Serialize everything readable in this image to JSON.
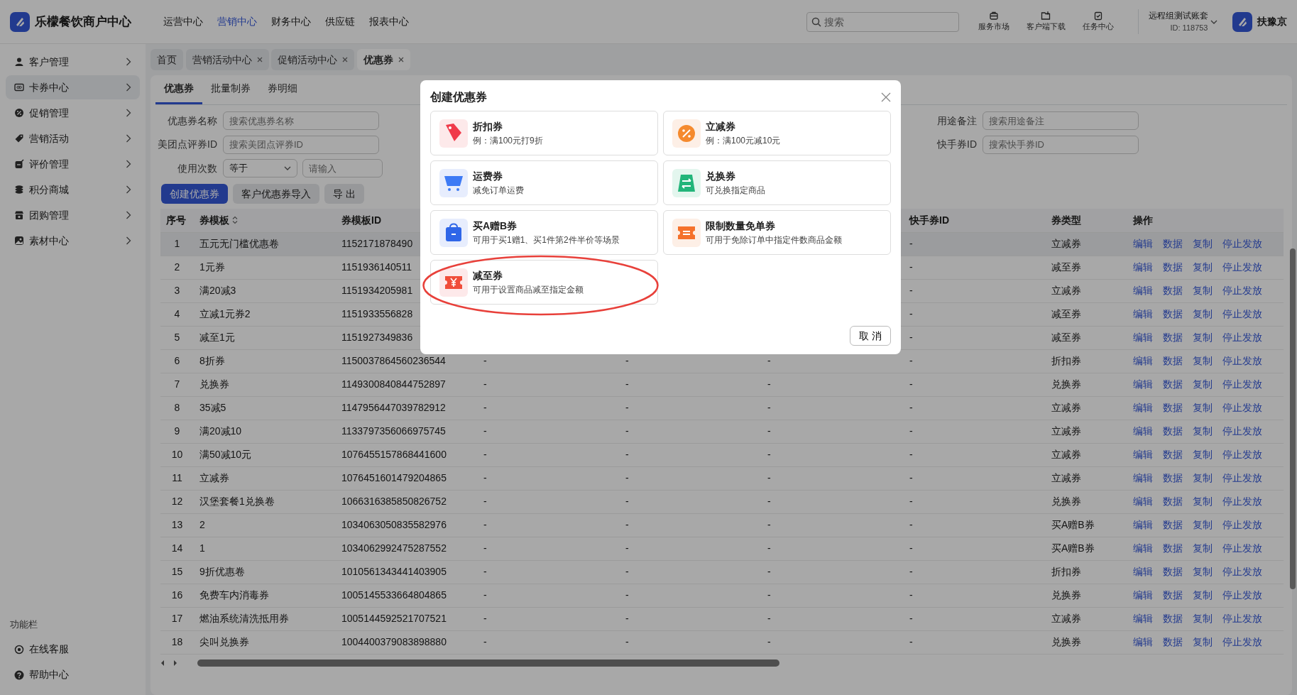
{
  "app": {
    "title": "乐檬餐饮商户中心"
  },
  "top_nav": [
    {
      "label": "运营中心",
      "selected": false
    },
    {
      "label": "营销中心",
      "selected": true
    },
    {
      "label": "财务中心",
      "selected": false
    },
    {
      "label": "供应链",
      "selected": false
    },
    {
      "label": "报表中心",
      "selected": false
    }
  ],
  "search": {
    "placeholder": "搜索"
  },
  "header_tools": [
    "服务市场",
    "客户端下载",
    "任务中心"
  ],
  "account": {
    "name": "远程组测试账套",
    "id": "ID: 118753"
  },
  "user": {
    "name": "扶豫京"
  },
  "sidebar": {
    "items": [
      {
        "label": "客户管理",
        "selected": false
      },
      {
        "label": "卡券中心",
        "selected": true
      },
      {
        "label": "促销管理",
        "selected": false
      },
      {
        "label": "营销活动",
        "selected": false
      },
      {
        "label": "评价管理",
        "selected": false
      },
      {
        "label": "积分商城",
        "selected": false
      },
      {
        "label": "团购管理",
        "selected": false
      },
      {
        "label": "素材中心",
        "selected": false
      }
    ],
    "footer_title": "功能栏",
    "footer_items": [
      "在线客服",
      "帮助中心"
    ]
  },
  "page_tabs": [
    {
      "label": "首页",
      "closable": false,
      "selected": false
    },
    {
      "label": "营销活动中心",
      "closable": true,
      "selected": false
    },
    {
      "label": "促销活动中心",
      "closable": true,
      "selected": false
    },
    {
      "label": "优惠券",
      "closable": true,
      "selected": true
    }
  ],
  "sub_tabs": [
    {
      "label": "优惠券",
      "selected": true
    },
    {
      "label": "批量制券",
      "selected": false
    },
    {
      "label": "券明细",
      "selected": false
    }
  ],
  "filter_groups": [
    [
      {
        "kind": "text",
        "label": "优惠券名称",
        "placeholder": "搜索优惠券名称"
      },
      {
        "kind": "text",
        "label": "美团点评券ID",
        "placeholder": "搜索美团点评券ID"
      },
      {
        "kind": "compare",
        "label": "使用次数",
        "value": "等于",
        "placeholder": "请输入"
      }
    ],
    [
      {
        "kind": "text",
        "label": "用途备注",
        "placeholder": "搜索用途备注"
      },
      {
        "kind": "text",
        "label": "快手券ID",
        "placeholder": "搜索快手券ID"
      }
    ]
  ],
  "actions": [
    {
      "label": "创建优惠券",
      "primary": true
    },
    {
      "label": "客户优惠券导入",
      "primary": false
    },
    {
      "label": "导 出",
      "primary": false
    }
  ],
  "table": {
    "columns": [
      {
        "label": "序号",
        "sortable": false
      },
      {
        "label": "券模板",
        "sortable": true
      },
      {
        "label": "券模板ID",
        "sortable": false
      },
      {
        "label": "快手券ID",
        "sortable": false
      },
      {
        "label": "券类型",
        "sortable": false
      },
      {
        "label": "操作",
        "sortable": false
      }
    ],
    "rows": [
      {
        "no": "1",
        "template": "五元无门槛优惠卷",
        "template_id": "1152171878490",
        "kuaishou_id": "-",
        "type": "立减券",
        "highlighted": true,
        "actions": [
          "编辑",
          "数据",
          "复制",
          "停止发放"
        ]
      },
      {
        "no": "2",
        "template": "1元券",
        "template_id": "1151936140511",
        "kuaishou_id": "-",
        "type": "减至券",
        "highlighted": false,
        "actions": [
          "编辑",
          "数据",
          "复制",
          "停止发放"
        ]
      },
      {
        "no": "3",
        "template": "满20减3",
        "template_id": "1151934205981",
        "kuaishou_id": "-",
        "type": "立减券",
        "highlighted": false,
        "actions": [
          "编辑",
          "数据",
          "复制",
          "停止发放"
        ]
      },
      {
        "no": "4",
        "template": "立减1元券2",
        "template_id": "1151933556828",
        "kuaishou_id": "-",
        "type": "减至券",
        "highlighted": false,
        "actions": [
          "编辑",
          "数据",
          "复制",
          "停止发放"
        ]
      },
      {
        "no": "5",
        "template": "减至1元",
        "template_id": "1151927349836",
        "kuaishou_id": "-",
        "type": "减至券",
        "highlighted": false,
        "actions": [
          "编辑",
          "数据",
          "复制",
          "停止发放"
        ]
      },
      {
        "no": "6",
        "template": "8折券",
        "template_id": "1150037864560236544",
        "column_4": "-",
        "column_5": "-",
        "column_6": "-",
        "kuaishou_id": "-",
        "type": "折扣券",
        "highlighted": false,
        "actions": [
          "编辑",
          "数据",
          "复制",
          "停止发放"
        ]
      },
      {
        "no": "7",
        "template": "兑换券",
        "template_id": "1149300840844752897",
        "column_4": "-",
        "column_5": "-",
        "column_6": "-",
        "kuaishou_id": "-",
        "type": "兑换券",
        "highlighted": false,
        "actions": [
          "编辑",
          "数据",
          "复制",
          "停止发放"
        ]
      },
      {
        "no": "8",
        "template": "35减5",
        "template_id": "1147956447039782912",
        "column_4": "-",
        "column_5": "-",
        "column_6": "-",
        "kuaishou_id": "-",
        "type": "立减券",
        "highlighted": false,
        "actions": [
          "编辑",
          "数据",
          "复制",
          "停止发放"
        ]
      },
      {
        "no": "9",
        "template": "满20减10",
        "template_id": "1133797356066975745",
        "column_4": "-",
        "column_5": "-",
        "column_6": "-",
        "kuaishou_id": "-",
        "type": "立减券",
        "highlighted": false,
        "actions": [
          "编辑",
          "数据",
          "复制",
          "停止发放"
        ]
      },
      {
        "no": "10",
        "template": "满50减10元",
        "template_id": "1076455157868441600",
        "column_4": "-",
        "column_5": "-",
        "column_6": "-",
        "kuaishou_id": "-",
        "type": "立减券",
        "highlighted": false,
        "actions": [
          "编辑",
          "数据",
          "复制",
          "停止发放"
        ]
      },
      {
        "no": "11",
        "template": "立减券",
        "template_id": "1076451601479204865",
        "column_4": "-",
        "column_5": "-",
        "column_6": "-",
        "kuaishou_id": "-",
        "type": "立减券",
        "highlighted": false,
        "actions": [
          "编辑",
          "数据",
          "复制",
          "停止发放"
        ]
      },
      {
        "no": "12",
        "template": "汉堡套餐1兑换卷",
        "template_id": "1066316385850826752",
        "column_4": "-",
        "column_5": "-",
        "column_6": "-",
        "kuaishou_id": "-",
        "type": "兑换券",
        "highlighted": false,
        "actions": [
          "编辑",
          "数据",
          "复制",
          "停止发放"
        ]
      },
      {
        "no": "13",
        "template": "2",
        "template_id": "1034063050835582976",
        "column_4": "-",
        "column_5": "-",
        "column_6": "-",
        "kuaishou_id": "-",
        "type": "买A赠B券",
        "highlighted": false,
        "actions": [
          "编辑",
          "数据",
          "复制",
          "停止发放"
        ]
      },
      {
        "no": "14",
        "template": "1",
        "template_id": "1034062992475287552",
        "column_4": "-",
        "column_5": "-",
        "column_6": "-",
        "kuaishou_id": "-",
        "type": "买A赠B券",
        "highlighted": false,
        "actions": [
          "编辑",
          "数据",
          "复制",
          "停止发放"
        ]
      },
      {
        "no": "15",
        "template": "9折优惠卷",
        "template_id": "1010561343441403905",
        "column_4": "-",
        "column_5": "-",
        "column_6": "-",
        "kuaishou_id": "-",
        "type": "折扣券",
        "highlighted": false,
        "actions": [
          "编辑",
          "数据",
          "复制",
          "停止发放"
        ]
      },
      {
        "no": "16",
        "template": "免费车内消毒券",
        "template_id": "1005145533664804865",
        "column_4": "-",
        "column_5": "-",
        "column_6": "-",
        "kuaishou_id": "-",
        "type": "兑换券",
        "highlighted": false,
        "actions": [
          "编辑",
          "数据",
          "复制",
          "停止发放"
        ]
      },
      {
        "no": "17",
        "template": "燃油系统清洗抵用券",
        "template_id": "1005144592521707521",
        "column_4": "-",
        "column_5": "-",
        "column_6": "-",
        "kuaishou_id": "-",
        "type": "立减券",
        "highlighted": false,
        "actions": [
          "编辑",
          "数据",
          "复制",
          "停止发放"
        ]
      },
      {
        "no": "18",
        "template": "尖叫兑换券",
        "template_id": "1004400379083898880",
        "column_4": "-",
        "column_5": "-",
        "column_6": "-",
        "kuaishou_id": "-",
        "type": "兑换券",
        "highlighted": false,
        "actions": [
          "编辑",
          "数据",
          "复制",
          "停止发放"
        ]
      }
    ]
  },
  "modal": {
    "title": "创建优惠券",
    "cancel": "取 消",
    "options": [
      {
        "title": "折扣券",
        "description": "例：满100元打9折",
        "highlighted": false
      },
      {
        "title": "立减券",
        "description": "例：满100元减10元",
        "highlighted": false
      },
      {
        "title": "运费券",
        "description": "减免订单运费",
        "highlighted": false
      },
      {
        "title": "兑换券",
        "description": "可兑换指定商品",
        "highlighted": false
      },
      {
        "title": "买A赠B券",
        "description": "可用于买1赠1、买1件第2件半价等场景",
        "highlighted": false
      },
      {
        "title": "限制数量免单券",
        "description": "可用于免除订单中指定件数商品金额",
        "highlighted": false
      },
      {
        "title": "减至券",
        "description": "可用于设置商品减至指定金额",
        "highlighted": true
      }
    ]
  }
}
